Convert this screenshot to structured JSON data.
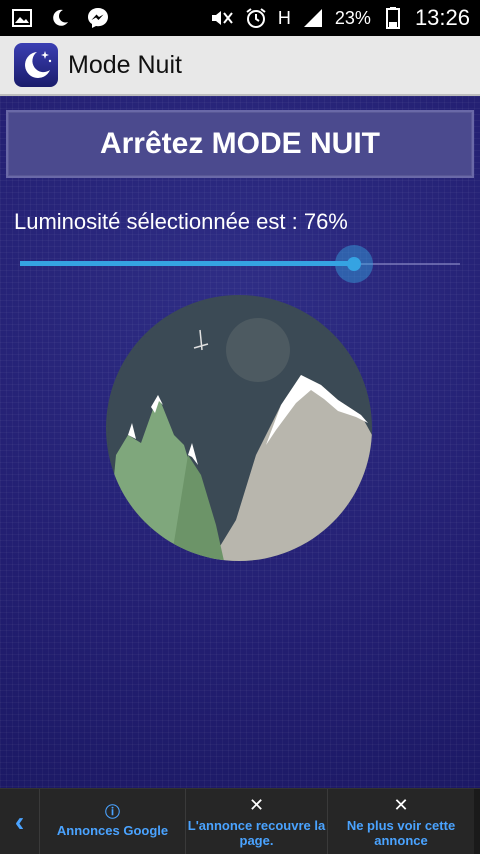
{
  "status_bar": {
    "battery": "23%",
    "time": "13:26",
    "network": "H"
  },
  "app_bar": {
    "title": "Mode Nuit"
  },
  "main": {
    "stop_button_label": "Arrêtez MODE NUIT",
    "brightness_label": "Luminosité sélectionnée est : 76%",
    "brightness_value": 0.76
  },
  "ad_bar": {
    "google_label": "Annonces Google",
    "cover_label": "L'annonce recouvre la page.",
    "never_label": "Ne plus voir cette annonce"
  },
  "colors": {
    "accent": "#35a3e2",
    "background": "#231f72"
  }
}
